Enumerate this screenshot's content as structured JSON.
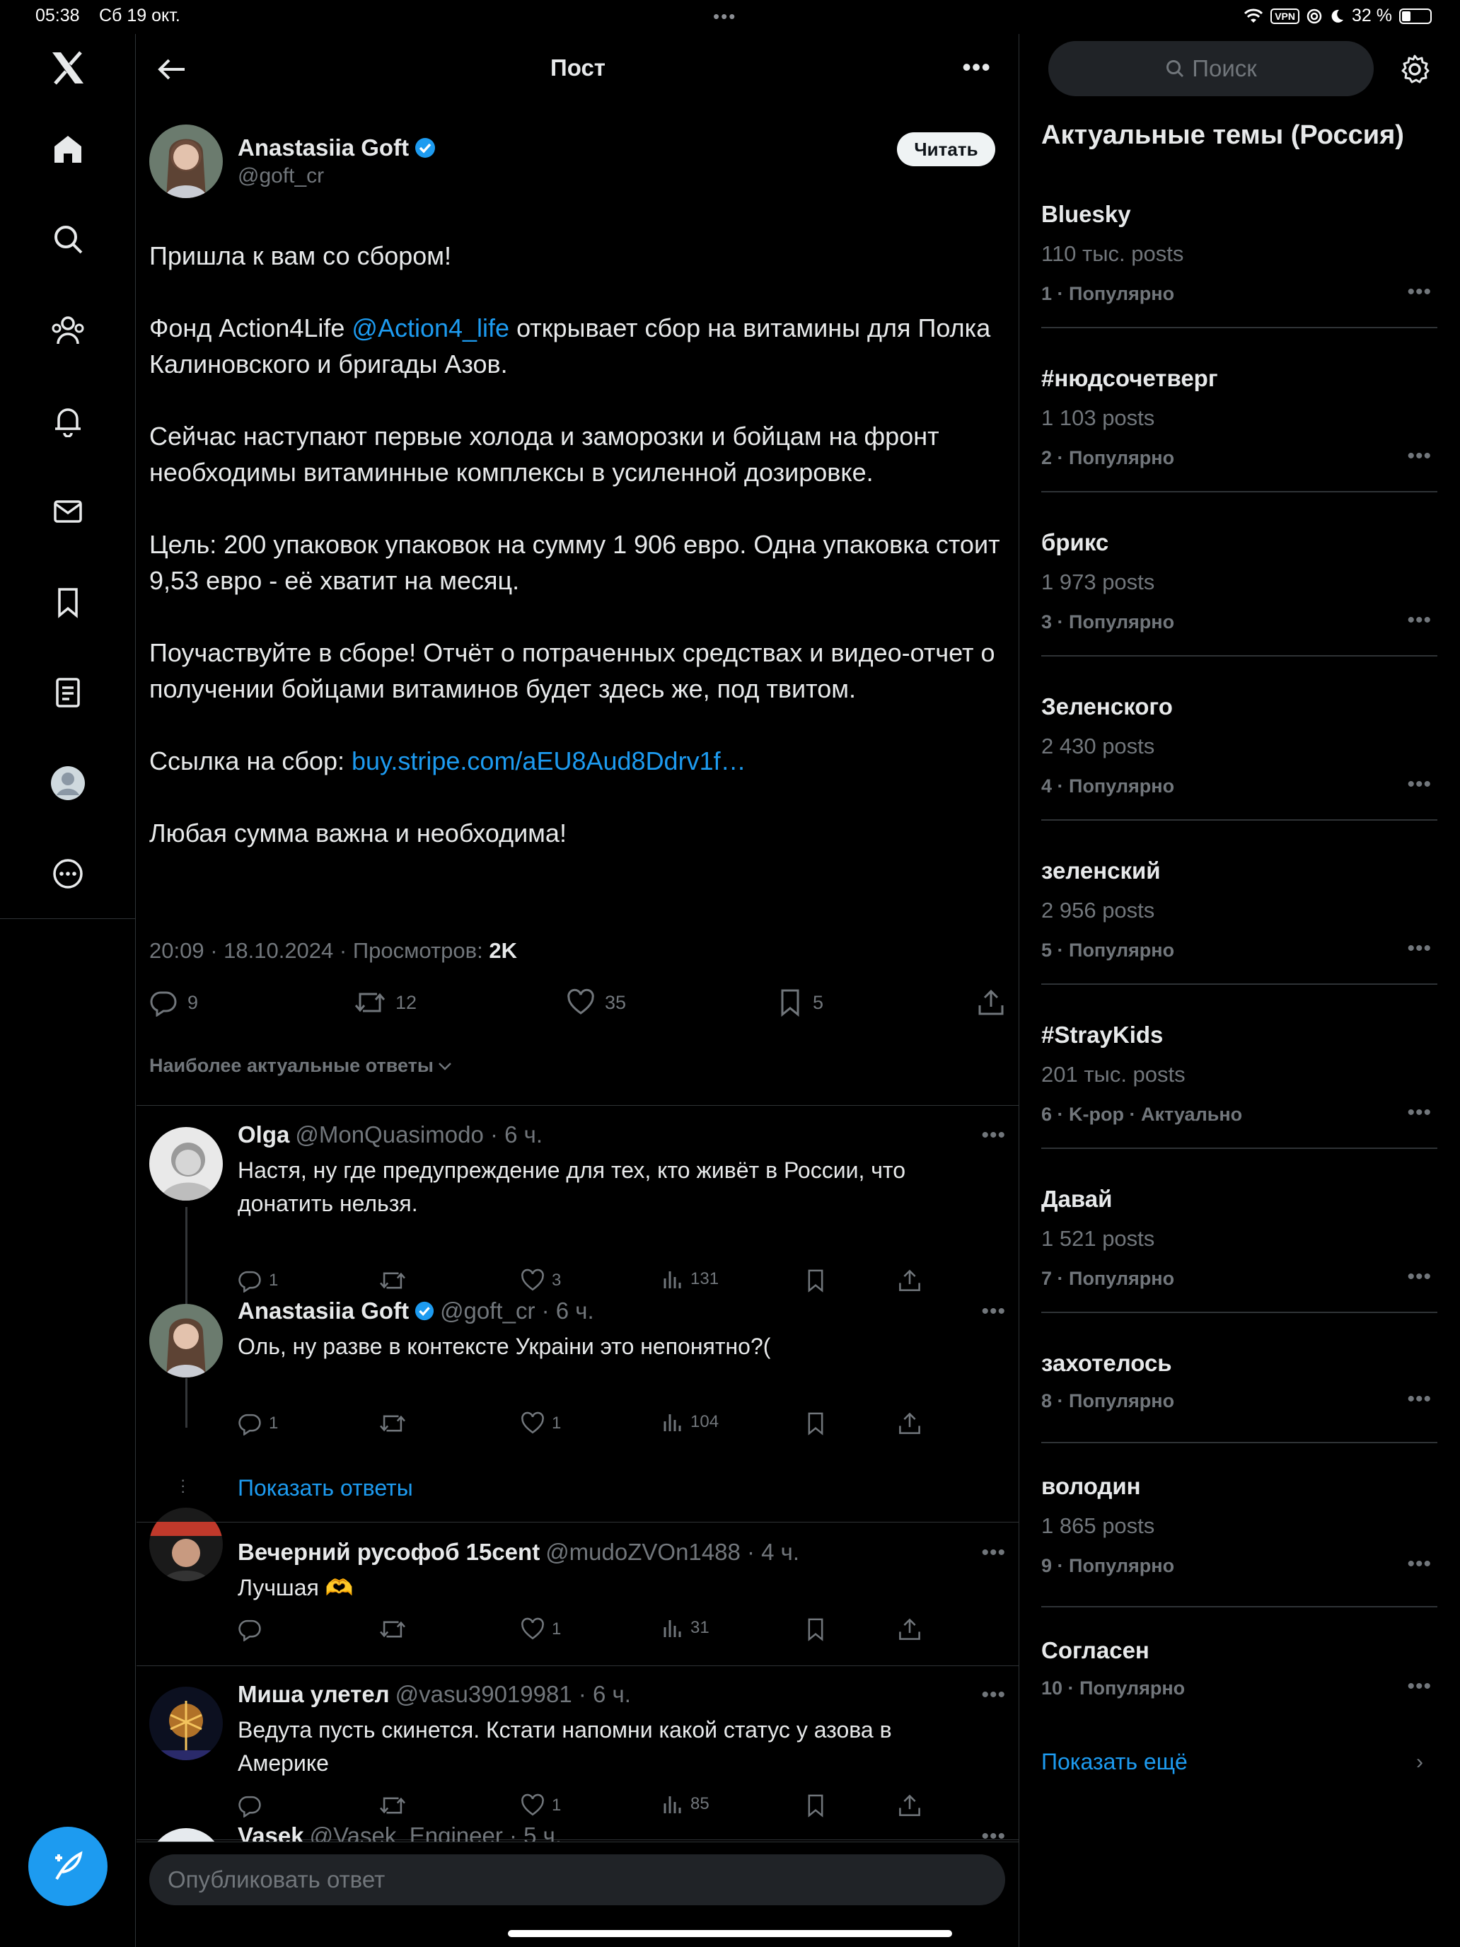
{
  "status_bar": {
    "time": "05:38",
    "date": "Сб 19 окт.",
    "dots": "•••",
    "vpn": "VPN",
    "battery": "32 %",
    "battery_level": 0.32
  },
  "nav": {
    "items": [
      "x-logo",
      "home",
      "search",
      "communities",
      "notifications",
      "messages",
      "bookmarks",
      "lists",
      "profile",
      "more"
    ]
  },
  "header": {
    "title": "Пост"
  },
  "post": {
    "author_name": "Anastasiia Goft",
    "author_handle": "@goft_cr",
    "follow_label": "Читать",
    "p1": "Пришла к вам со сбором!",
    "p2_before": "Фонд Action4Life ",
    "p2_mention": "@Action4_life",
    "p2_after": " открывает сбор на витамины для Полка Калиновского и бригады Азов.",
    "p3": "Сейчас наступают первые холода и заморозки и бойцам на фронт необходимы витаминные комплексы в усиленной дозировке.",
    "p4": "Цель: 200 упаковок упаковок на сумму 1 906 евро. Одна упаковка стоит 9,53 евро - её хватит на месяц.",
    "p5": "Поучаствуйте в сборе! Отчёт о потраченных средствах и видео-отчет о получении бойцами витаминов будет здесь же, под твитом.",
    "p6_label": "Ссылка на сбор: ",
    "p6_link": "buy.stripe.com/aEU8Aud8Ddrv1f…",
    "p7": "Любая сумма важна и необходима!",
    "meta": "20:09 · 18.10.2024 · Просмотров: ",
    "views": "2K",
    "replies": "9",
    "reposts": "12",
    "likes": "35",
    "bookmarks": "5"
  },
  "sort_label": "Наиболее актуальные ответы",
  "replies": [
    {
      "name": "Olga",
      "handle": "@MonQuasimodo · 6 ч.",
      "text": "Настя, ну где предупреждение для тех, кто живёт в России, что донатить нельзя.",
      "replies": "1",
      "reposts": "",
      "likes": "3",
      "views": "131"
    },
    {
      "name": "Anastasiia Goft",
      "handle": "@goft_cr · 6 ч.",
      "text": "Оль, ну разве в контексте Украіни это непонятно?(",
      "replies": "1",
      "reposts": "",
      "likes": "1",
      "views": "104"
    },
    {
      "name": "Вечерний русофоб 15cent",
      "handle": "@mudoZVOn1488 · 4 ч.",
      "text": "Лучшая 🫶",
      "replies": "",
      "reposts": "",
      "likes": "1",
      "views": "31"
    },
    {
      "name": "Миша улетел",
      "handle": "@vasu39019981 · 6 ч.",
      "text": "Ведута пусть скинется. Кстати напомни какой статус у азова в Америке",
      "replies": "",
      "reposts": "",
      "likes": "1",
      "views": "85"
    },
    {
      "name": "Vasek",
      "handle": "@Vasek_Engineer · 5 ч."
    }
  ],
  "show_replies": "Показать ответы",
  "reply_placeholder": "Опубликовать ответ",
  "sidebar": {
    "search_placeholder": "Поиск",
    "title": "Актуальные темы (Россия)",
    "trends": [
      {
        "name": "Bluesky",
        "count": "110 тыс. posts",
        "rank": "1",
        "label": "Популярно"
      },
      {
        "name": "#нюдсочетверг",
        "count": "1 103 posts",
        "rank": "2",
        "label": "Популярно"
      },
      {
        "name": "брикс",
        "count": "1 973 posts",
        "rank": "3",
        "label": "Популярно"
      },
      {
        "name": "Зеленского",
        "count": "2 430 posts",
        "rank": "4",
        "label": "Популярно"
      },
      {
        "name": "зеленский",
        "count": "2 956 posts",
        "rank": "5",
        "label": "Популярно"
      },
      {
        "name": "#StrayKids",
        "count": "201 тыс. posts",
        "rank": "6",
        "label": "K-pop · Актуально"
      },
      {
        "name": "Давай",
        "count": "1 521 posts",
        "rank": "7",
        "label": "Популярно"
      },
      {
        "name": "захотелось",
        "count": "",
        "rank": "8",
        "label": "Популярно"
      },
      {
        "name": "володин",
        "count": "1 865 posts",
        "rank": "9",
        "label": "Популярно"
      },
      {
        "name": "Согласен",
        "count": "",
        "rank": "10",
        "label": "Популярно"
      }
    ],
    "show_more": "Показать ещё"
  },
  "colors": {
    "accent": "#1d9bf0",
    "background": "#000000",
    "muted": "#71767b",
    "border": "#2f3336"
  }
}
